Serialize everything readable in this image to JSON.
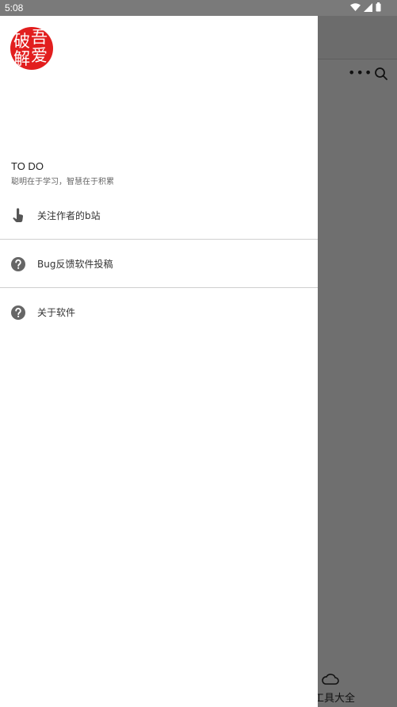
{
  "status_bar": {
    "time": "5:08"
  },
  "drawer": {
    "logo_text": "吾爱破解",
    "title": "TO DO",
    "subtitle": "聪明在于学习，智慧在于积累",
    "menu": [
      {
        "label": "关注作者的b站",
        "icon": "hand-pointer-icon"
      },
      {
        "label": "Bug反馈软件投稿",
        "icon": "help-icon"
      },
      {
        "label": "关于软件",
        "icon": "help-icon"
      }
    ]
  },
  "background": {
    "more_label": "•••",
    "bottom_tab_label": "工具大全"
  }
}
